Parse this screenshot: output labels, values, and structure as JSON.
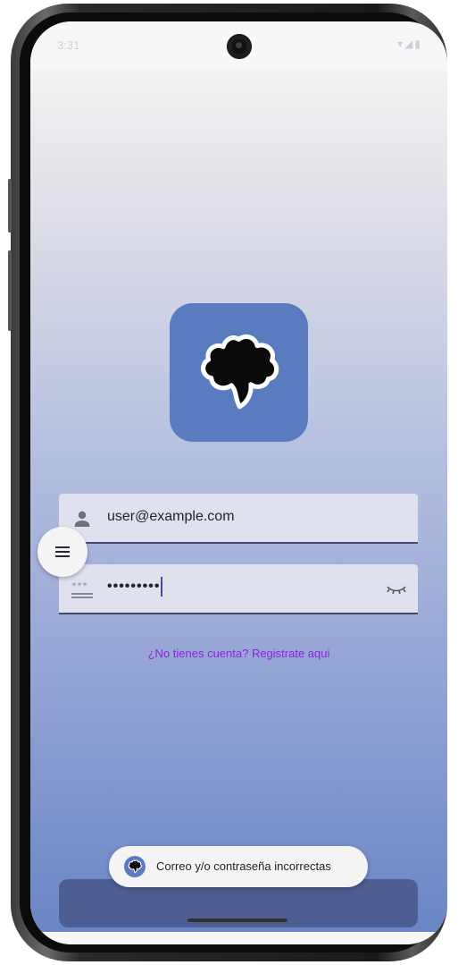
{
  "status_bar": {
    "time": "3:31",
    "icons": "▾◢▮"
  },
  "login": {
    "email_value": "user@example.com",
    "password_value": "•••••••••",
    "register_link": "¿No tienes cuenta? Registrate aqui"
  },
  "snackbar": {
    "message": "Correo y/o contraseña incorrectas"
  },
  "colors": {
    "logo_bg": "#5b7bc0",
    "link": "#8f1fe0",
    "bottom_bar": "#4e5e93",
    "field_bg": "#dfe2ee"
  },
  "icons": {
    "email_field": "person-icon",
    "password_field": "password-icon",
    "password_toggle": "eye-closed-icon",
    "fab": "menu-icon",
    "logo": "puzzle-blob-logo"
  }
}
